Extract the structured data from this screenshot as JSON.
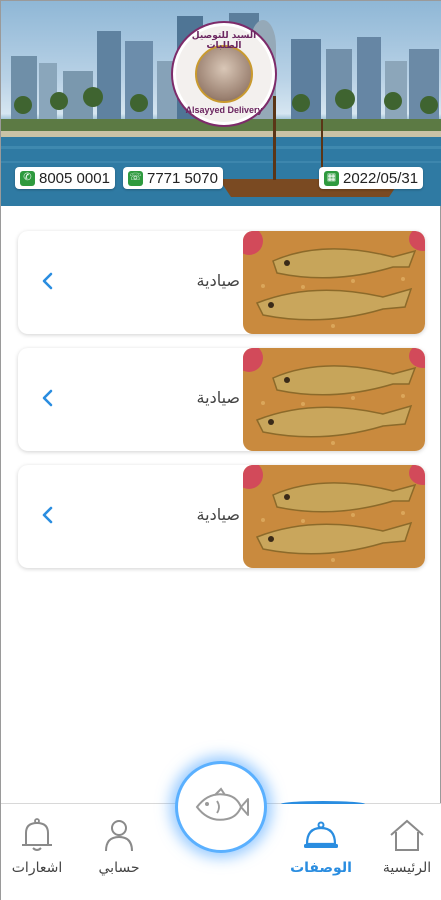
{
  "header": {
    "logo_arabic": "السيد للتوصيل الطلبات",
    "logo_latin": "Alsayyed Delivery",
    "phone": "8005 0001",
    "whatsapp": "7771 5070",
    "date": "2022/05/31",
    "phone_icon": "phone-icon",
    "whatsapp_icon": "whatsapp-icon",
    "calendar_icon": "calendar-icon"
  },
  "recipes": [
    {
      "title": "صيادية"
    },
    {
      "title": "صيادية"
    },
    {
      "title": "صيادية"
    }
  ],
  "nav": {
    "home": "الرئيسية",
    "recipes": "الوصفات",
    "account": "حسابي",
    "notifications": "اشعارات",
    "active": "recipes"
  },
  "colors": {
    "accent": "#2a8de0",
    "badge_green": "#2e9a3e",
    "logo_purple": "#7d2b6a"
  }
}
